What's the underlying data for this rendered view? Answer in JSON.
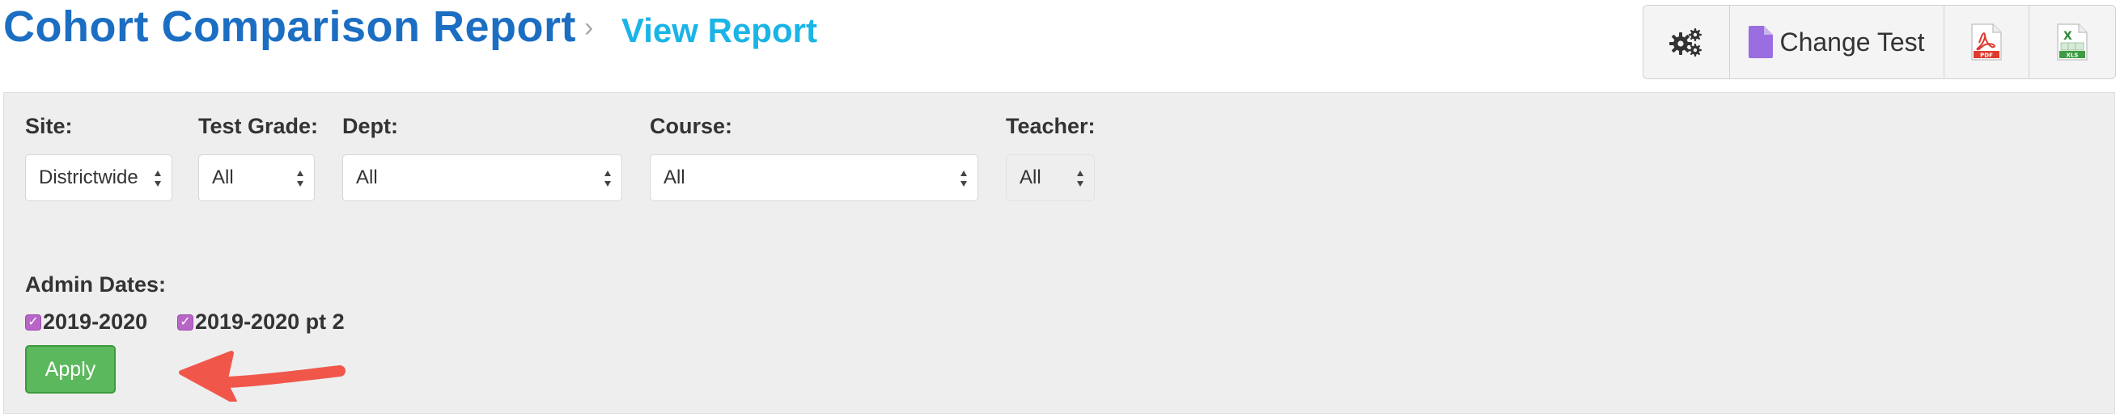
{
  "header": {
    "title": "Cohort Comparison Report",
    "breadcrumb_separator": "›",
    "breadcrumb_current": "View Report"
  },
  "toolbar": {
    "settings_icon": "gears-icon",
    "change_test_label": "Change Test",
    "change_test_icon": "file-icon",
    "pdf_icon": "pdf-file-icon",
    "pdf_icon_text": "PDF",
    "xls_icon": "excel-file-icon",
    "xls_icon_mark": "X",
    "xls_icon_text": "XLS"
  },
  "filters": {
    "site": {
      "label": "Site:",
      "value": "Districtwide"
    },
    "test_grade": {
      "label": "Test Grade:",
      "value": "All"
    },
    "dept": {
      "label": "Dept:",
      "value": "All"
    },
    "course": {
      "label": "Course:",
      "value": "All"
    },
    "teacher": {
      "label": "Teacher:",
      "value": "All",
      "disabled": true
    }
  },
  "admin_dates": {
    "label": "Admin Dates:",
    "options": [
      {
        "label": "2019-2020",
        "checked": true
      },
      {
        "label": "2019-2020 pt 2",
        "checked": true
      }
    ]
  },
  "apply_label": "Apply",
  "colors": {
    "title": "#1b6ec2",
    "breadcrumb": "#1ab4e6",
    "panel_bg": "#eeeeee",
    "checkbox": "#b766c8",
    "apply_bg": "#5cb85c",
    "annotation_arrow": "#f0574a"
  }
}
